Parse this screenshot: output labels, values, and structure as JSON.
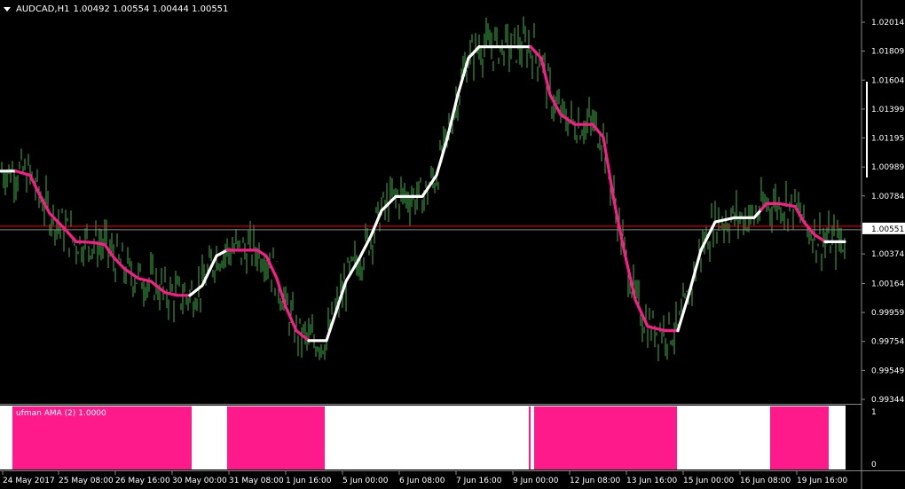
{
  "window": {
    "symbol": "AUDCAD,H1",
    "ohlc": "1.00492 1.00554 1.00444 1.00551"
  },
  "colors": {
    "background": "#000000",
    "candles": "#3cb043",
    "ama_up": "#ffffff",
    "ama_down": "#ff1a8c",
    "bid_line": "#ff0000",
    "grid_text": "#ffffff"
  },
  "price_axis": {
    "labels": [
      "1.02014",
      "1.01809",
      "1.01604",
      "1.01399",
      "1.01195",
      "1.00989",
      "1.00784",
      "1.00551",
      "1.00374",
      "1.00164",
      "0.99959",
      "0.99754",
      "0.99549",
      "0.99344"
    ],
    "current_price": "1.00551"
  },
  "time_axis": {
    "labels": [
      "24 May 2017",
      "25 May 08:00",
      "26 May 16:00",
      "30 May 00:00",
      "31 May 08:00",
      "1 Jun 16:00",
      "5 Jun 00:00",
      "6 Jun 08:00",
      "7 Jun 16:00",
      "9 Jun 00:00",
      "12 Jun 08:00",
      "13 Jun 16:00",
      "15 Jun 00:00",
      "16 Jun 08:00",
      "19 Jun 16:00"
    ]
  },
  "indicator": {
    "label": "ufman AMA (2) 1.0000",
    "scale_top": "1",
    "scale_bottom": "0"
  },
  "chart_data": {
    "type": "line",
    "title": "AUDCAD,H1",
    "ylim": [
      0.99344,
      1.02014
    ],
    "series": [
      {
        "name": "",
        "points": [
          [
            0,
            1.0096
          ],
          [
            18,
            1.0096
          ],
          [
            34,
            1.0093
          ],
          [
            44,
            1.008
          ],
          [
            56,
            1.0066
          ],
          [
            70,
            1.0057
          ],
          [
            86,
            1.0046
          ],
          [
            104,
            1.00455
          ],
          [
            118,
            1.0044
          ],
          [
            128,
            1.0035
          ],
          [
            140,
            1.0027
          ],
          [
            156,
            1.002
          ],
          [
            170,
            1.0018
          ],
          [
            186,
            1.001
          ],
          [
            200,
            1.0008
          ],
          [
            214,
            1.0008
          ],
          [
            228,
            1.0015
          ],
          [
            244,
            1.0036
          ],
          [
            256,
            1.004
          ],
          [
            270,
            1.004
          ],
          [
            290,
            1.004
          ],
          [
            300,
            1.0036
          ],
          [
            312,
            1.002
          ],
          [
            322,
            1.0
          ],
          [
            334,
            0.9983
          ],
          [
            348,
            0.9976
          ],
          [
            368,
            0.9976
          ],
          [
            378,
            0.9995
          ],
          [
            390,
            1.0018
          ],
          [
            404,
            1.0033
          ],
          [
            418,
            1.005
          ],
          [
            430,
            1.0068
          ],
          [
            446,
            1.0078
          ],
          [
            464,
            1.0078
          ],
          [
            476,
            1.0078
          ],
          [
            492,
            1.0093
          ],
          [
            504,
            1.0119
          ],
          [
            516,
            1.015
          ],
          [
            528,
            1.0176
          ],
          [
            540,
            1.0184
          ],
          [
            570,
            1.0184
          ],
          [
            598,
            1.0184
          ],
          [
            610,
            1.0176
          ],
          [
            620,
            1.015
          ],
          [
            632,
            1.0136
          ],
          [
            648,
            1.0129
          ],
          [
            668,
            1.0129
          ],
          [
            680,
            1.012
          ],
          [
            692,
            1.0075
          ],
          [
            704,
            1.0038
          ],
          [
            716,
            1.0005
          ],
          [
            730,
            0.9986
          ],
          [
            750,
            0.9983
          ],
          [
            764,
            0.9983
          ],
          [
            776,
            1.0008
          ],
          [
            790,
            1.004
          ],
          [
            806,
            1.006
          ],
          [
            828,
            1.0063
          ],
          [
            850,
            1.0063
          ],
          [
            864,
            1.0073
          ],
          [
            878,
            1.0073
          ],
          [
            896,
            1.0071
          ],
          [
            906,
            1.006
          ],
          [
            918,
            1.0051
          ],
          [
            930,
            1.0046
          ],
          [
            944,
            1.0046
          ],
          [
            952,
            1.0046
          ]
        ]
      }
    ],
    "ama_direction": [
      [
        0,
        18,
        "up"
      ],
      [
        18,
        214,
        "down"
      ],
      [
        214,
        256,
        "up"
      ],
      [
        256,
        348,
        "down"
      ],
      [
        348,
        478,
        "up"
      ],
      [
        478,
        540,
        "up"
      ],
      [
        540,
        598,
        "up"
      ],
      [
        598,
        668,
        "down"
      ],
      [
        668,
        764,
        "down"
      ],
      [
        764,
        858,
        "up"
      ],
      [
        858,
        930,
        "down"
      ],
      [
        930,
        952,
        "up"
      ]
    ],
    "indicator_blocks": [
      [
        14,
        216,
        1
      ],
      [
        256,
        366,
        1
      ],
      [
        596,
        598,
        1
      ],
      [
        602,
        763,
        1
      ],
      [
        868,
        934,
        1
      ]
    ]
  }
}
